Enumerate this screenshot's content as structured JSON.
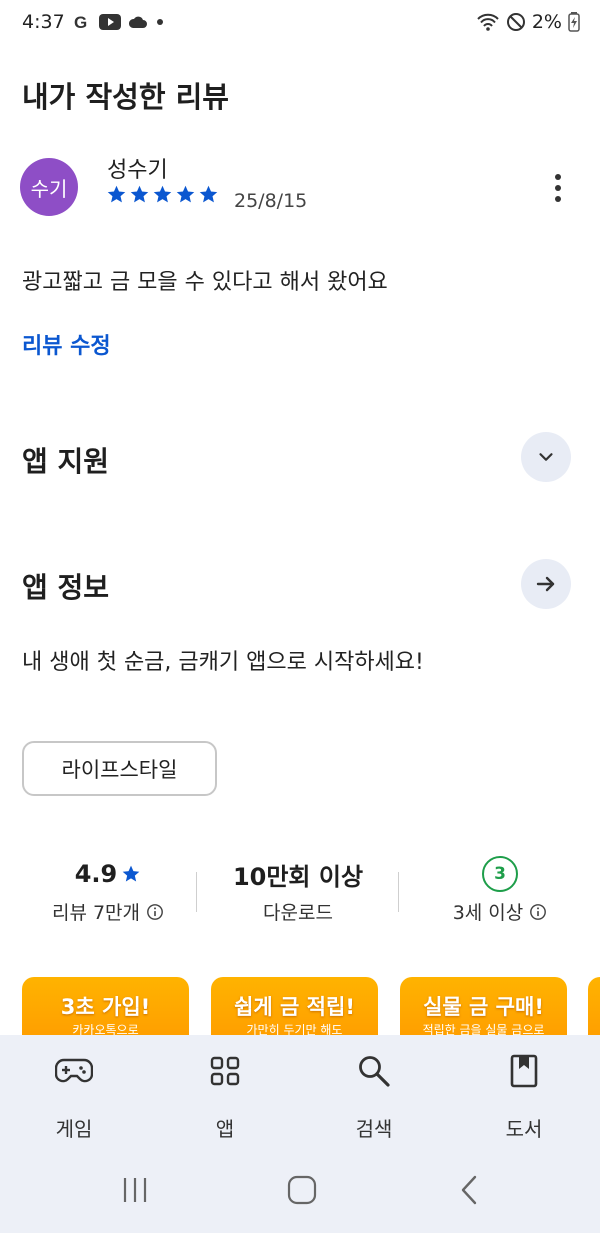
{
  "status_bar": {
    "time": "4:37",
    "notification_icons": [
      "google-icon",
      "youtube-icon",
      "cloud-icon",
      "dot-icon"
    ],
    "battery_percent": "2%",
    "system_icons": [
      "wifi-icon",
      "do-not-disturb-icon",
      "battery-charging-icon"
    ]
  },
  "page": {
    "title": "내가 작성한 리뷰"
  },
  "review": {
    "avatar_text": "수기",
    "avatar_color": "#8e4ec6",
    "reviewer_name": "성수기",
    "rating": 5,
    "rating_max": 5,
    "date": "25/8/15",
    "text": "광고짧고 금 모을 수 있다고 해서 왔어요",
    "edit_label": "리뷰 수정"
  },
  "app_support": {
    "title": "앱 지원",
    "icon": "chevron-down-icon"
  },
  "app_info": {
    "title": "앱 정보",
    "icon": "arrow-right-icon",
    "description": "내 생애 첫 순금, 금캐기 앱으로 시작하세요!",
    "category_chip": "라이프스타일"
  },
  "stats": {
    "rating_value": "4.9",
    "rating_label": "리뷰 7만개",
    "downloads_value": "10만회 이상",
    "downloads_label": "다운로드",
    "age_badge": "3",
    "age_label": "3세 이상"
  },
  "promos": [
    {
      "title": "3초 가입!",
      "subtitle": "카카오톡으로"
    },
    {
      "title": "쉽게 금 적립!",
      "subtitle": "가만히 두기만 해도"
    },
    {
      "title": "실물 금 구매!",
      "subtitle": "적립한 금을 실물 금으로"
    }
  ],
  "bottom_nav": [
    {
      "label": "게임",
      "icon": "gamepad-icon"
    },
    {
      "label": "앱",
      "icon": "apps-grid-icon"
    },
    {
      "label": "검색",
      "icon": "search-icon"
    },
    {
      "label": "도서",
      "icon": "book-icon"
    }
  ],
  "system_nav": [
    "recents-icon",
    "home-icon",
    "back-icon"
  ],
  "colors": {
    "accent_blue": "#0b57d0",
    "star_blue": "#0b57d0",
    "age_green": "#1e9e4a",
    "promo_orange": "#ff9800",
    "nav_bg": "#edf0f7"
  }
}
